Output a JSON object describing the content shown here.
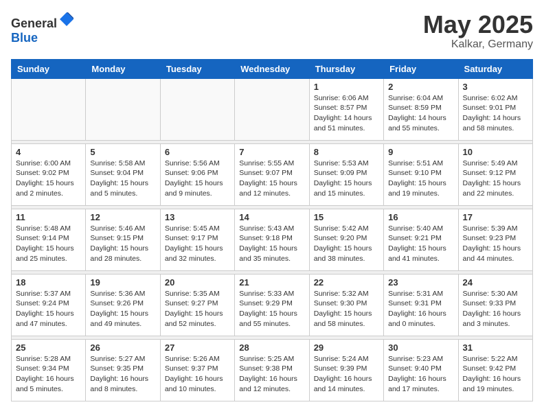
{
  "header": {
    "logo_general": "General",
    "logo_blue": "Blue",
    "month": "May 2025",
    "location": "Kalkar, Germany"
  },
  "weekdays": [
    "Sunday",
    "Monday",
    "Tuesday",
    "Wednesday",
    "Thursday",
    "Friday",
    "Saturday"
  ],
  "weeks": [
    [
      {
        "day": "",
        "info": ""
      },
      {
        "day": "",
        "info": ""
      },
      {
        "day": "",
        "info": ""
      },
      {
        "day": "",
        "info": ""
      },
      {
        "day": "1",
        "info": "Sunrise: 6:06 AM\nSunset: 8:57 PM\nDaylight: 14 hours\nand 51 minutes."
      },
      {
        "day": "2",
        "info": "Sunrise: 6:04 AM\nSunset: 8:59 PM\nDaylight: 14 hours\nand 55 minutes."
      },
      {
        "day": "3",
        "info": "Sunrise: 6:02 AM\nSunset: 9:01 PM\nDaylight: 14 hours\nand 58 minutes."
      }
    ],
    [
      {
        "day": "4",
        "info": "Sunrise: 6:00 AM\nSunset: 9:02 PM\nDaylight: 15 hours\nand 2 minutes."
      },
      {
        "day": "5",
        "info": "Sunrise: 5:58 AM\nSunset: 9:04 PM\nDaylight: 15 hours\nand 5 minutes."
      },
      {
        "day": "6",
        "info": "Sunrise: 5:56 AM\nSunset: 9:06 PM\nDaylight: 15 hours\nand 9 minutes."
      },
      {
        "day": "7",
        "info": "Sunrise: 5:55 AM\nSunset: 9:07 PM\nDaylight: 15 hours\nand 12 minutes."
      },
      {
        "day": "8",
        "info": "Sunrise: 5:53 AM\nSunset: 9:09 PM\nDaylight: 15 hours\nand 15 minutes."
      },
      {
        "day": "9",
        "info": "Sunrise: 5:51 AM\nSunset: 9:10 PM\nDaylight: 15 hours\nand 19 minutes."
      },
      {
        "day": "10",
        "info": "Sunrise: 5:49 AM\nSunset: 9:12 PM\nDaylight: 15 hours\nand 22 minutes."
      }
    ],
    [
      {
        "day": "11",
        "info": "Sunrise: 5:48 AM\nSunset: 9:14 PM\nDaylight: 15 hours\nand 25 minutes."
      },
      {
        "day": "12",
        "info": "Sunrise: 5:46 AM\nSunset: 9:15 PM\nDaylight: 15 hours\nand 28 minutes."
      },
      {
        "day": "13",
        "info": "Sunrise: 5:45 AM\nSunset: 9:17 PM\nDaylight: 15 hours\nand 32 minutes."
      },
      {
        "day": "14",
        "info": "Sunrise: 5:43 AM\nSunset: 9:18 PM\nDaylight: 15 hours\nand 35 minutes."
      },
      {
        "day": "15",
        "info": "Sunrise: 5:42 AM\nSunset: 9:20 PM\nDaylight: 15 hours\nand 38 minutes."
      },
      {
        "day": "16",
        "info": "Sunrise: 5:40 AM\nSunset: 9:21 PM\nDaylight: 15 hours\nand 41 minutes."
      },
      {
        "day": "17",
        "info": "Sunrise: 5:39 AM\nSunset: 9:23 PM\nDaylight: 15 hours\nand 44 minutes."
      }
    ],
    [
      {
        "day": "18",
        "info": "Sunrise: 5:37 AM\nSunset: 9:24 PM\nDaylight: 15 hours\nand 47 minutes."
      },
      {
        "day": "19",
        "info": "Sunrise: 5:36 AM\nSunset: 9:26 PM\nDaylight: 15 hours\nand 49 minutes."
      },
      {
        "day": "20",
        "info": "Sunrise: 5:35 AM\nSunset: 9:27 PM\nDaylight: 15 hours\nand 52 minutes."
      },
      {
        "day": "21",
        "info": "Sunrise: 5:33 AM\nSunset: 9:29 PM\nDaylight: 15 hours\nand 55 minutes."
      },
      {
        "day": "22",
        "info": "Sunrise: 5:32 AM\nSunset: 9:30 PM\nDaylight: 15 hours\nand 58 minutes."
      },
      {
        "day": "23",
        "info": "Sunrise: 5:31 AM\nSunset: 9:31 PM\nDaylight: 16 hours\nand 0 minutes."
      },
      {
        "day": "24",
        "info": "Sunrise: 5:30 AM\nSunset: 9:33 PM\nDaylight: 16 hours\nand 3 minutes."
      }
    ],
    [
      {
        "day": "25",
        "info": "Sunrise: 5:28 AM\nSunset: 9:34 PM\nDaylight: 16 hours\nand 5 minutes."
      },
      {
        "day": "26",
        "info": "Sunrise: 5:27 AM\nSunset: 9:35 PM\nDaylight: 16 hours\nand 8 minutes."
      },
      {
        "day": "27",
        "info": "Sunrise: 5:26 AM\nSunset: 9:37 PM\nDaylight: 16 hours\nand 10 minutes."
      },
      {
        "day": "28",
        "info": "Sunrise: 5:25 AM\nSunset: 9:38 PM\nDaylight: 16 hours\nand 12 minutes."
      },
      {
        "day": "29",
        "info": "Sunrise: 5:24 AM\nSunset: 9:39 PM\nDaylight: 16 hours\nand 14 minutes."
      },
      {
        "day": "30",
        "info": "Sunrise: 5:23 AM\nSunset: 9:40 PM\nDaylight: 16 hours\nand 17 minutes."
      },
      {
        "day": "31",
        "info": "Sunrise: 5:22 AM\nSunset: 9:42 PM\nDaylight: 16 hours\nand 19 minutes."
      }
    ]
  ]
}
